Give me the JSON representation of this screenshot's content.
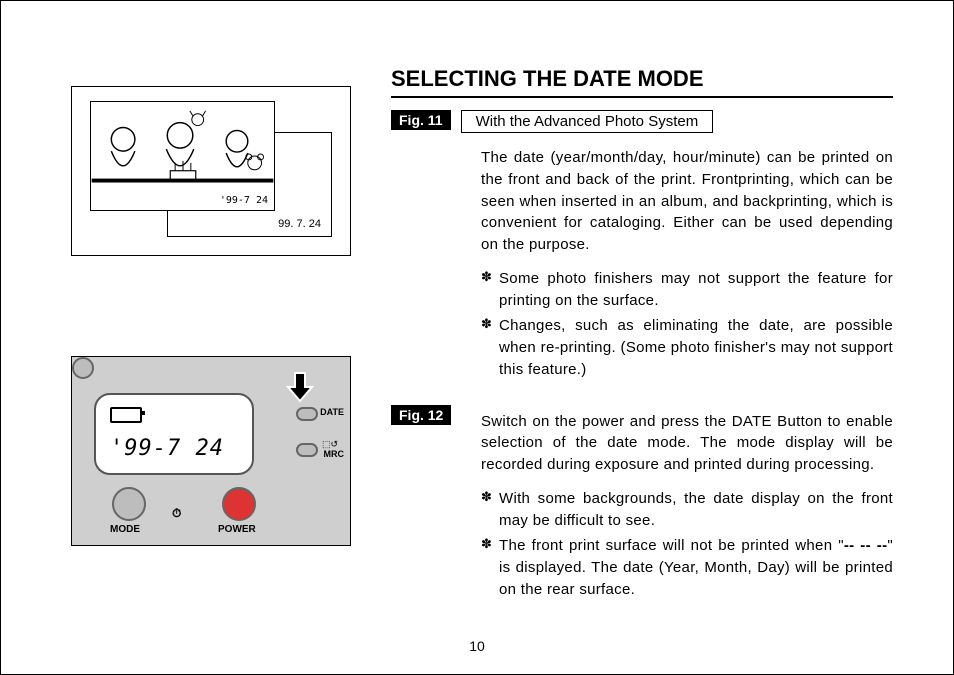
{
  "title": "SELECTING THE DATE MODE",
  "page_number": "10",
  "fig11": {
    "label": "Fig. 11",
    "sub": "With the Advanced Photo System",
    "body": "The date (year/month/day, hour/minute) can be printed on the front and back of the print. Frontprinting, which can be seen when inserted in an album, and backprinting, which is convenient for cataloging.  Either can be used depending on the purpose.",
    "bullets": [
      "Some photo finishers may not support the feature for printing on the surface.",
      "Changes, such as eliminating the date, are possible when re-printing. (Some photo finisher's may not support this feature.)"
    ],
    "photo_date_back": "99. 7. 24",
    "photo_date_front": "'99-7 24"
  },
  "fig12": {
    "label": "Fig. 12",
    "body": "Switch on the power and press the DATE Button to enable selection of the date mode. The mode display will be recorded during exposure and printed during processing.",
    "bullets": [
      "With some backgrounds, the date display on the front may be difficult to see.",
      "The front print surface will not be printed when \"-- -- --\" is displayed. The date (Year, Month, Day) will be printed on the rear surface."
    ],
    "lcd_date": "'99-7 24",
    "mode_label": "MODE",
    "power_label": "POWER",
    "timer_label": "⏱",
    "date_label": "DATE",
    "mrc_label": "MRC",
    "mrc_icon": "⬚↺"
  }
}
